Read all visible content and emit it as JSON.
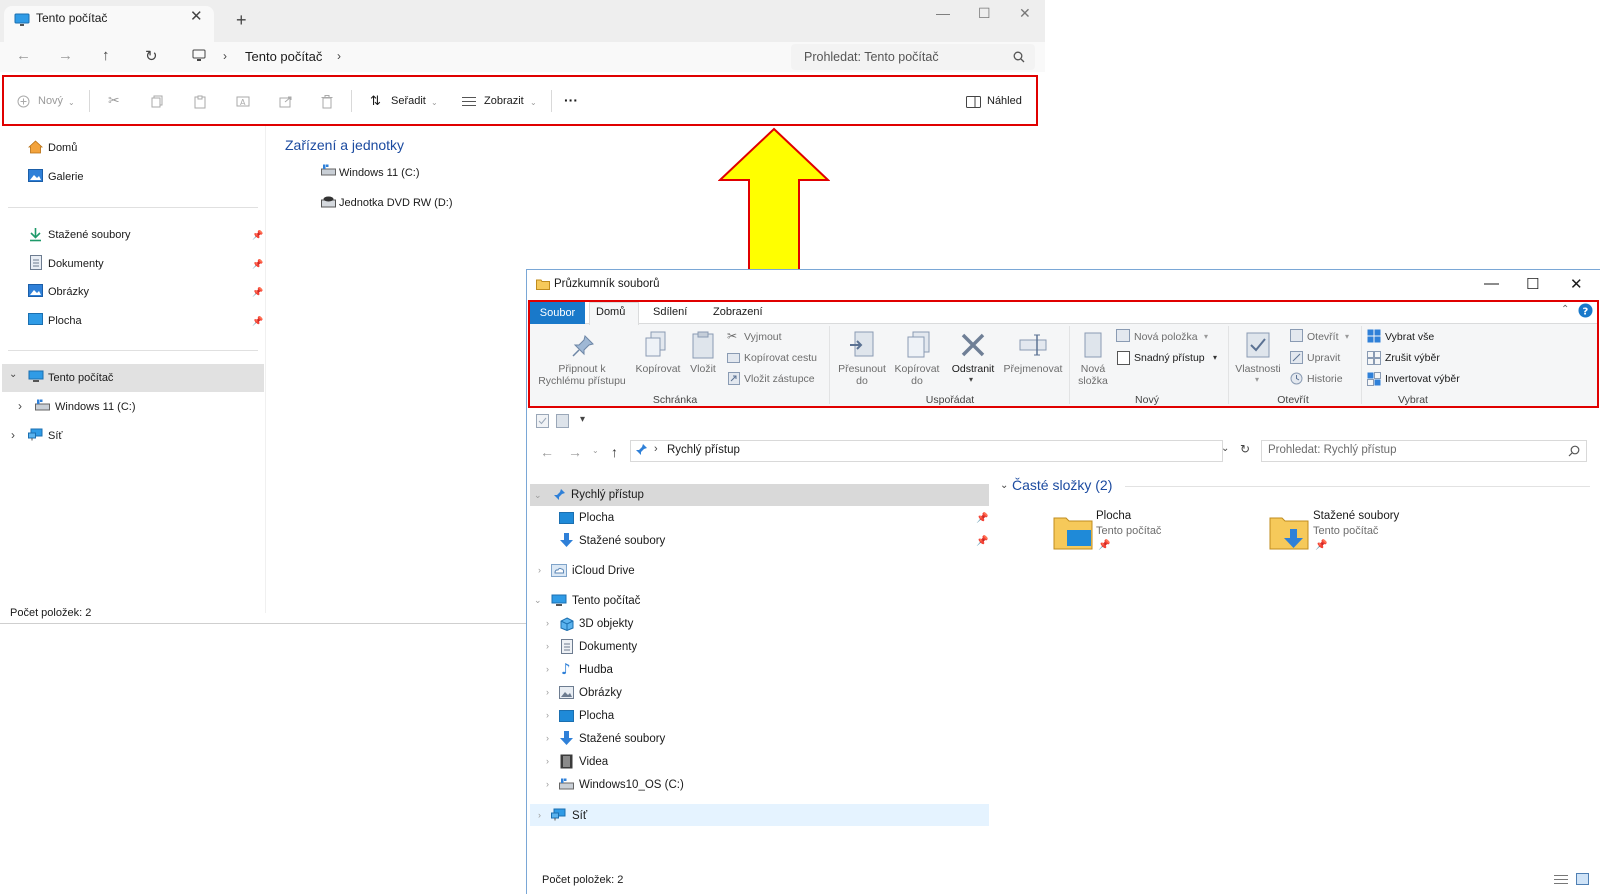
{
  "win1": {
    "tab_title": "Tento počítač",
    "new_tab": "+",
    "close": "✕",
    "breadcrumb": "Tento počítač",
    "search_placeholder": "Prohledat: Tento počítač",
    "toolbar": {
      "new": "Nový",
      "sort": "Seřadit",
      "view": "Zobrazit",
      "more": "···",
      "preview": "Náhled"
    },
    "nav": {
      "home": "Domů",
      "gallery": "Galerie",
      "pinned": [
        "Stažené soubory",
        "Dokumenty",
        "Obrázky",
        "Plocha"
      ],
      "this_pc": "Tento počítač",
      "drive": "Windows 11 (C:)",
      "network": "Síť"
    },
    "section_title": "Zařízení a jednotky",
    "drives": [
      "Windows 11 (C:)",
      "Jednotka DVD RW (D:)"
    ],
    "status": "Počet položek: 2"
  },
  "win2": {
    "title": "Průzkumník souborů",
    "tabs": {
      "file": "Soubor",
      "home": "Domů",
      "share": "Sdílení",
      "view": "Zobrazení"
    },
    "ribbon": {
      "pin_line1": "Připnout k",
      "pin_line2": "Rychlému přístupu",
      "copy": "Kopírovat",
      "paste": "Vložit",
      "cut": "Vyjmout",
      "copy_path": "Kopírovat cestu",
      "paste_shortcut": "Vložit zástupce",
      "group_clipboard": "Schránka",
      "move_line1": "Přesunout",
      "move_line2": "do",
      "copyto_line1": "Kopírovat",
      "copyto_line2": "do",
      "delete": "Odstranit",
      "rename": "Přejmenovat",
      "group_organize": "Uspořádat",
      "new_folder_line1": "Nová",
      "new_folder_line2": "složka",
      "new_item": "Nová položka",
      "easy_access": "Snadný přístup",
      "group_new": "Nový",
      "properties": "Vlastnosti",
      "open": "Otevřít",
      "edit": "Upravit",
      "history": "Historie",
      "group_open": "Otevřít",
      "select_all": "Vybrat vše",
      "select_none": "Zrušit výběr",
      "invert": "Invertovat výběr",
      "group_select": "Vybrat"
    },
    "address": "Rychlý přístup",
    "search_placeholder": "Prohledat: Rychlý přístup",
    "tree": {
      "quick": "Rychlý přístup",
      "quick_items": [
        "Plocha",
        "Stažené soubory"
      ],
      "icloud": "iCloud Drive",
      "this_pc": "Tento počítač",
      "pc_items": [
        "3D objekty",
        "Dokumenty",
        "Hudba",
        "Obrázky",
        "Plocha",
        "Stažené soubory",
        "Videa",
        "Windows10_OS (C:)"
      ],
      "network": "Síť"
    },
    "section_title": "Časté složky (2)",
    "tiles": [
      {
        "name": "Plocha",
        "sub": "Tento počítač"
      },
      {
        "name": "Stažené soubory",
        "sub": "Tento počítač"
      }
    ],
    "status": "Počet položek: 2"
  },
  "colors": {
    "highlight": "#e00000",
    "arrow_fill": "#ffff00",
    "file_tab": "#1979ca",
    "section_text": "#1c4ba0"
  }
}
